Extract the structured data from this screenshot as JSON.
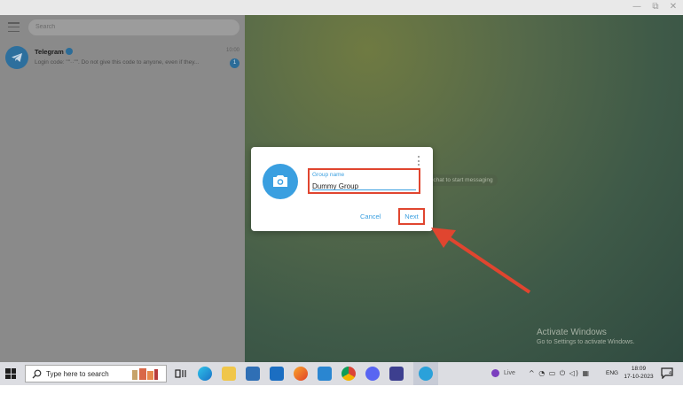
{
  "window": {
    "minimize_glyph": "—",
    "restore_glyph": "⧉",
    "close_glyph": "✕"
  },
  "sidebar": {
    "search_placeholder": "Search",
    "chats": [
      {
        "name": "Telegram",
        "time": "10:00",
        "preview": "Login code: \"\"··\"\". Do not give this code to anyone, even if they...",
        "unread": "1",
        "avatar_icon": "telegram-logo-icon"
      }
    ]
  },
  "main": {
    "empty_hint": "a chat to start messaging"
  },
  "dialog": {
    "field_label": "Group name",
    "field_value": "Dummy Group",
    "cancel_label": "Cancel",
    "next_label": "Next",
    "photo_icon": "camera-icon",
    "highlight_color": "#e0452f",
    "accent_color": "#3a9fe0"
  },
  "watermark": {
    "title": "Activate Windows",
    "subtitle": "Go to Settings to activate Windows."
  },
  "taskbar": {
    "search_placeholder": "Type here to search",
    "live_label": "Live",
    "language": "ENG",
    "time": "18:09",
    "date": "17-10-2023",
    "notification_count": "4"
  }
}
